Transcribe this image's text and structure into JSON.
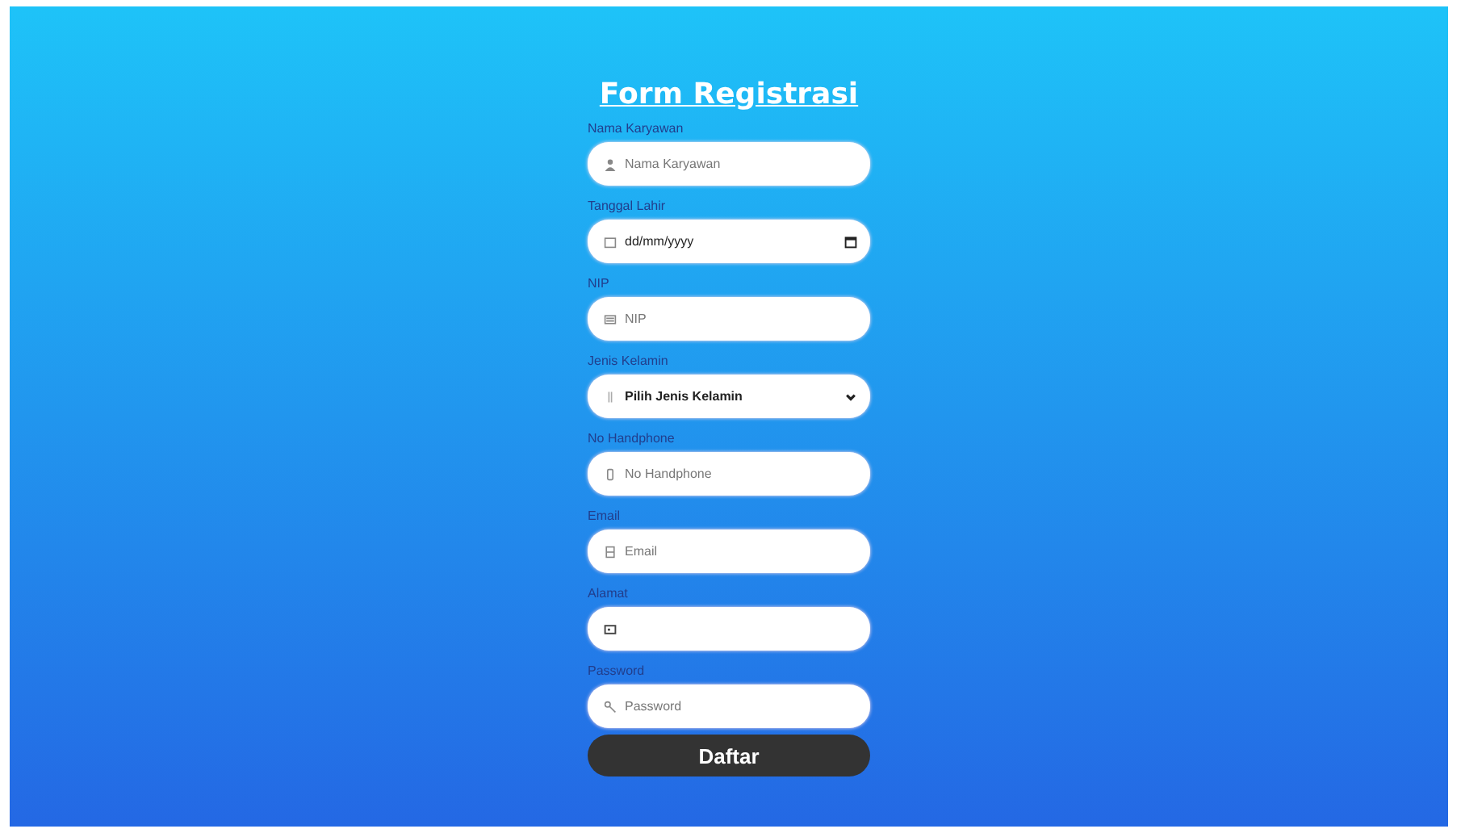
{
  "form": {
    "title": "Form Registrasi",
    "fields": [
      {
        "label": "Nama Karyawan",
        "kind": "text",
        "placeholder": "Nama Karyawan"
      },
      {
        "label": "Tanggal Lahir",
        "kind": "date",
        "value": "dd/mm/yyyy"
      },
      {
        "label": "NIP",
        "kind": "text",
        "placeholder": "NIP"
      },
      {
        "label": "Jenis Kelamin",
        "kind": "select",
        "value": "Pilih Jenis Kelamin"
      },
      {
        "label": "No Handphone",
        "kind": "text",
        "placeholder": "No Handphone"
      },
      {
        "label": "Email",
        "kind": "text",
        "placeholder": "Email"
      },
      {
        "label": "Alamat",
        "kind": "text"
      },
      {
        "label": "Password",
        "kind": "text",
        "placeholder": "Password"
      }
    ],
    "submit": "Daftar"
  }
}
